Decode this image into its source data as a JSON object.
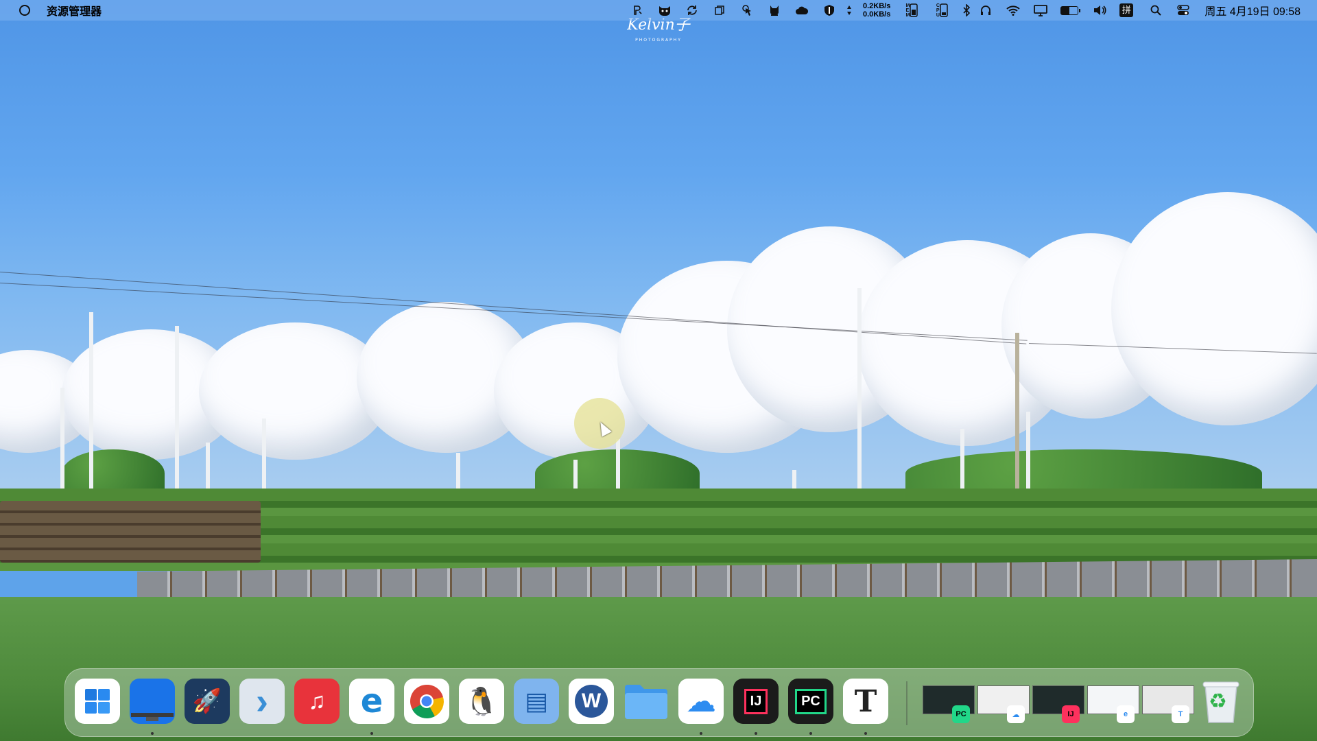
{
  "menubar": {
    "app_name": "资源管理器",
    "net_up": "0.2KB/s",
    "net_down": "0.0KB/s",
    "mem_label": "M\nE\nM",
    "cpu_label": "C\nP\nU",
    "clock": "周五 4月19日 09:58",
    "battery_level": 0.5,
    "icons": [
      "p-icon",
      "cat-face-icon",
      "sync-icon",
      "copy-icon",
      "pointer-icon",
      "pet-icon",
      "cloud-icon",
      "shield-icon",
      "up-down-arrow-icon",
      "memory-icon",
      "cpu-icon",
      "bluetooth-icon",
      "headphones-icon",
      "wifi-icon",
      "display-icon",
      "battery-icon",
      "volume-icon",
      "input-method-icon",
      "search-icon",
      "control-center-icon"
    ],
    "input_method_label": "拼"
  },
  "wallpaper": {
    "watermark": "Kelvin子",
    "watermark_sub": "PHOTOGRAPHY"
  },
  "dock": {
    "apps": [
      {
        "name": "windows-start",
        "glyph": "",
        "bg": "#ffffff",
        "running": false
      },
      {
        "name": "desktop",
        "glyph": "",
        "bg": "#1a73e8",
        "running": true
      },
      {
        "name": "launchpad-rocket",
        "glyph": "🚀",
        "bg": "#1d3a5f",
        "running": false
      },
      {
        "name": "terminal-arrow",
        "glyph": "›",
        "bg": "#dfe6ee",
        "running": false
      },
      {
        "name": "netease-music",
        "glyph": "♫",
        "bg": "#e8333b",
        "running": false
      },
      {
        "name": "microsoft-edge",
        "glyph": "e",
        "bg": "#ffffff",
        "running": true
      },
      {
        "name": "google-chrome",
        "glyph": "",
        "bg": "#ffffff",
        "running": false
      },
      {
        "name": "qq",
        "glyph": "🐧",
        "bg": "#ffffff",
        "running": false
      },
      {
        "name": "file-explorer",
        "glyph": "▤",
        "bg": "#7fb4ee",
        "running": false
      },
      {
        "name": "microsoft-word",
        "glyph": "W",
        "bg": "#ffffff",
        "running": false
      },
      {
        "name": "folder",
        "glyph": "",
        "bg": "transparent",
        "running": false
      },
      {
        "name": "baidu-netdisk",
        "glyph": "☁",
        "bg": "#ffffff",
        "running": true
      },
      {
        "name": "intellij-idea",
        "glyph": "IJ",
        "bg": "#1b1b1b",
        "running": true
      },
      {
        "name": "pycharm",
        "glyph": "PC",
        "bg": "#1b1b1b",
        "running": true
      },
      {
        "name": "typora",
        "glyph": "T",
        "bg": "#ffffff",
        "running": true
      }
    ],
    "windows": [
      {
        "name": "pycharm-window",
        "badge": "PC",
        "badge_bg": "#21d789"
      },
      {
        "name": "netdisk-window",
        "badge": "☁",
        "badge_bg": "#ffffff"
      },
      {
        "name": "idea-window",
        "badge": "IJ",
        "badge_bg": "#fe315d"
      },
      {
        "name": "edge-window",
        "badge": "e",
        "badge_bg": "#ffffff"
      },
      {
        "name": "typora-window",
        "badge": "T",
        "badge_bg": "#ffffff"
      }
    ],
    "trash_glyph": "♻"
  }
}
